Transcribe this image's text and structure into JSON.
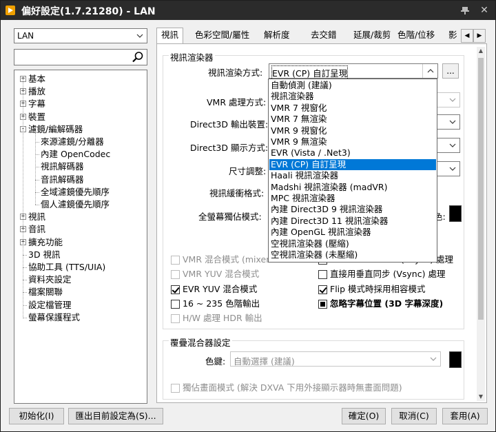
{
  "window": {
    "title": "偏好設定(1.7.21280) - LAN"
  },
  "titlebar": {
    "pin": "📌",
    "close": "✕"
  },
  "left": {
    "profile_value": "LAN",
    "search_placeholder": "",
    "tree": [
      {
        "label": "基本",
        "level": 0,
        "expander": "+"
      },
      {
        "label": "播放",
        "level": 0,
        "expander": "+"
      },
      {
        "label": "字幕",
        "level": 0,
        "expander": "+"
      },
      {
        "label": "裝置",
        "level": 0,
        "expander": "+"
      },
      {
        "label": "濾鏡/編解碼器",
        "level": 0,
        "expander": "-"
      },
      {
        "label": "來源濾鏡/分離器",
        "level": 1
      },
      {
        "label": "內建 OpenCodec",
        "level": 1
      },
      {
        "label": "視訊解碼器",
        "level": 1
      },
      {
        "label": "音訊解碼器",
        "level": 1
      },
      {
        "label": "全域濾鏡優先順序",
        "level": 1
      },
      {
        "label": "個人濾鏡優先順序",
        "level": 1
      },
      {
        "label": "視訊",
        "level": 0,
        "expander": "+"
      },
      {
        "label": "音訊",
        "level": 0,
        "expander": "+"
      },
      {
        "label": "擴充功能",
        "level": 0,
        "expander": "+"
      },
      {
        "label": "3D 視訊",
        "level": 0
      },
      {
        "label": "協助工具 (TTS/UIA)",
        "level": 0
      },
      {
        "label": "資料夾設定",
        "level": 0
      },
      {
        "label": "檔案關聯",
        "level": 0
      },
      {
        "label": "設定檔管理",
        "level": 0
      },
      {
        "label": "螢幕保護程式",
        "level": 0
      }
    ]
  },
  "tabs": [
    "視訊",
    "色彩空間/屬性",
    "解析度",
    "去交錯",
    "延展/裁剪",
    "色階/位移",
    "影"
  ],
  "renderer_group": {
    "title": "視訊渲染器",
    "render_method_label": "視訊渲染方式:",
    "render_method_value": "EVR (CP) 自訂呈現",
    "more_button": "...",
    "vmr_label": "VMR 處理方式:",
    "d3d_output_label": "Direct3D 輸出裝置:",
    "d3d_display_label": "Direct3D 顯示方式:",
    "size_label": "尺寸調整:",
    "buffer_label": "視訊緩衝格式:",
    "fullscreen_label": "全螢幕獨佔模式:",
    "color_suffix": "色:",
    "dropdown_options": [
      "自動偵測 (建議)",
      "視訊渲染器",
      "VMR 7 視窗化",
      "VMR 7 無渲染",
      "VMR 9 視窗化",
      "VMR 9 無渲染",
      "EVR (Vista / .Net3)",
      "EVR (CP) 自訂呈現",
      "Haali 視訊渲染器",
      "Madshi 視訊渲染器 (madVR)",
      "MPC 視訊渲染器",
      "內建 Direct3D 9 視訊渲染器",
      "內建 Direct3D 11 視訊渲染器",
      "內建 OpenGL 視訊渲染器",
      "空視訊渲染器 (壓縮)",
      "空視訊渲染器 (未壓縮)"
    ],
    "selected_option_index": 7
  },
  "checks": {
    "vmr_mixer": "VMR 混合模式 (mixer",
    "vmr_yuv": "VMR YUV 混合模式",
    "evr_yuv": "EVR YUV 混合模式",
    "range_16_235": "16 ~ 235 色階輸出",
    "hw_hdr": "H/W 處理 HDR 輸出",
    "right_1": "(Vsync) 處理",
    "direct_vsync": "直接用垂直同步 (Vsync) 處理",
    "flip_mode": "Flip 模式時採用相容模式",
    "ignore_sub": "忽略字幕位置 (3D 字幕深度)"
  },
  "overlay_group": {
    "title": "覆疊混合器設定",
    "color_key_label": "色鍵:",
    "color_key_value": "自動選擇 (建議)",
    "exclusive": "獨佔畫面模式 (解決 DXVA 下用外接顯示器時無畫面問題)"
  },
  "bottom": {
    "reset": "初始化(I)",
    "export": "匯出目前設定為(S)...",
    "ok": "確定(O)",
    "cancel": "取消(C)",
    "apply": "套用(A)"
  }
}
